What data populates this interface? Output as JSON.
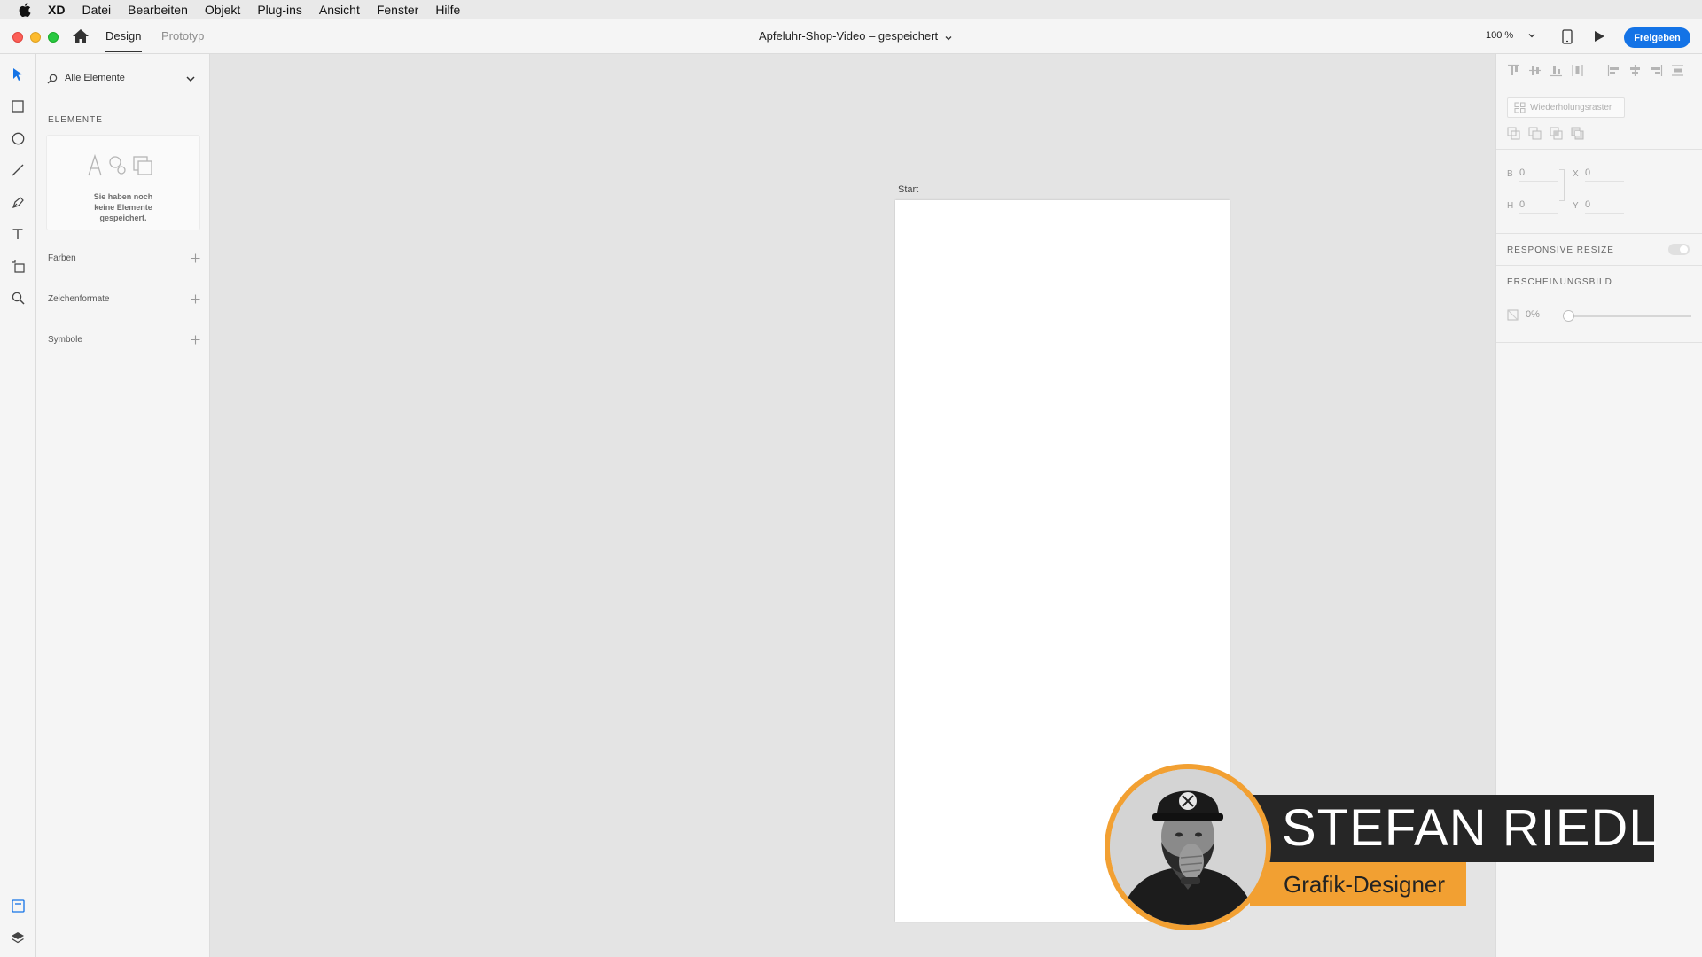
{
  "menubar": {
    "app_name": "XD",
    "items": [
      "Datei",
      "Bearbeiten",
      "Objekt",
      "Plug-ins",
      "Ansicht",
      "Fenster",
      "Hilfe"
    ]
  },
  "titlebar": {
    "tabs": {
      "design": "Design",
      "prototype": "Prototyp"
    },
    "document_title": "Apfeluhr-Shop-Video – gespeichert",
    "zoom": "100 %",
    "share_label": "Freigeben"
  },
  "assets": {
    "filter": "Alle Elemente",
    "section_title": "ELEMENTE",
    "empty_message": "Sie haben noch\nkeine Elemente\ngespeichert.",
    "rows": {
      "colors": "Farben",
      "char_styles": "Zeichenformate",
      "symbols": "Symbole"
    }
  },
  "canvas": {
    "artboard_name": "Start"
  },
  "inspector": {
    "repeat_grid": "Wiederholungsraster",
    "w_label": "B",
    "w_value": "0",
    "x_label": "X",
    "x_value": "0",
    "h_label": "H",
    "h_value": "0",
    "y_label": "Y",
    "y_value": "0",
    "responsive_resize": "RESPONSIVE RESIZE",
    "appearance": "ERSCHEINUNGSBILD",
    "opacity": "0%"
  },
  "overlay": {
    "name": "STEFAN RIEDL",
    "role": "Grafik-Designer"
  },
  "colors": {
    "accent": "#1473e6",
    "badge_orange": "#f2a032",
    "badge_dark": "#262626"
  }
}
